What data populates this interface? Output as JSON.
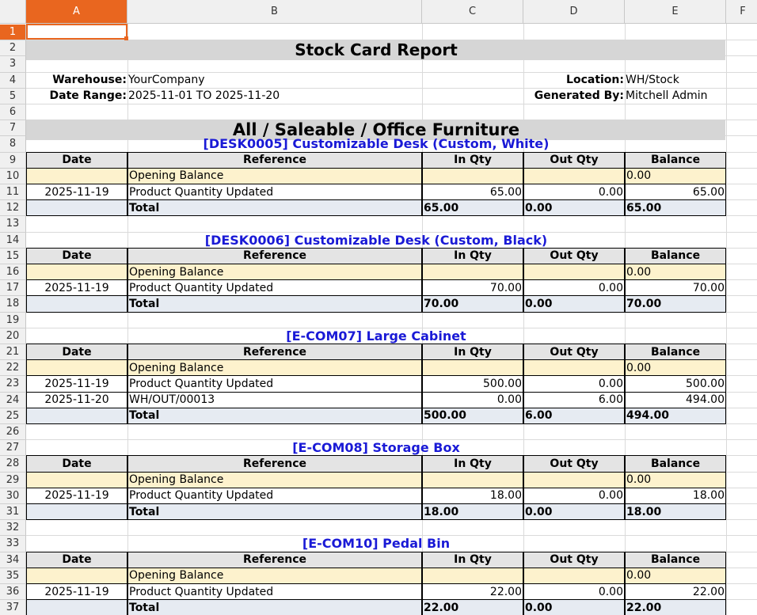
{
  "columns": [
    "A",
    "B",
    "C",
    "D",
    "E",
    "F"
  ],
  "selected_cell": "A1",
  "report": {
    "title": "Stock Card Report",
    "warehouse_label": "Warehouse:",
    "warehouse": "YourCompany",
    "location_label": "Location:",
    "location": "WH/Stock",
    "date_range_label": "Date Range:",
    "date_range": "2025-11-01 TO 2025-11-20",
    "generated_by_label": "Generated By:",
    "generated_by": "Mitchell Admin",
    "category": "All / Saleable / Office Furniture"
  },
  "table_headers": [
    "Date",
    "Reference",
    "In Qty",
    "Out Qty",
    "Balance"
  ],
  "labels": {
    "opening_balance": "Opening Balance",
    "total": "Total"
  },
  "products": [
    {
      "name": "[DESK0005] Customizable Desk (Custom, White)",
      "opening_balance": "0.00",
      "moves": [
        {
          "date": "2025-11-19",
          "reference": "Product Quantity Updated",
          "in": "65.00",
          "out": "0.00",
          "balance": "65.00"
        }
      ],
      "total": {
        "in": "65.00",
        "out": "0.00",
        "balance": "65.00"
      }
    },
    {
      "name": "[DESK0006] Customizable Desk (Custom, Black)",
      "opening_balance": "0.00",
      "moves": [
        {
          "date": "2025-11-19",
          "reference": "Product Quantity Updated",
          "in": "70.00",
          "out": "0.00",
          "balance": "70.00"
        }
      ],
      "total": {
        "in": "70.00",
        "out": "0.00",
        "balance": "70.00"
      }
    },
    {
      "name": "[E-COM07] Large Cabinet",
      "opening_balance": "0.00",
      "moves": [
        {
          "date": "2025-11-19",
          "reference": "Product Quantity Updated",
          "in": "500.00",
          "out": "0.00",
          "balance": "500.00"
        },
        {
          "date": "2025-11-20",
          "reference": "WH/OUT/00013",
          "in": "0.00",
          "out": "6.00",
          "balance": "494.00"
        }
      ],
      "total": {
        "in": "500.00",
        "out": "6.00",
        "balance": "494.00"
      }
    },
    {
      "name": "[E-COM08] Storage Box",
      "opening_balance": "0.00",
      "moves": [
        {
          "date": "2025-11-19",
          "reference": "Product Quantity Updated",
          "in": "18.00",
          "out": "0.00",
          "balance": "18.00"
        }
      ],
      "total": {
        "in": "18.00",
        "out": "0.00",
        "balance": "18.00"
      }
    },
    {
      "name": "[E-COM10] Pedal Bin",
      "opening_balance": "0.00",
      "moves": [
        {
          "date": "2025-11-19",
          "reference": "Product Quantity Updated",
          "in": "22.00",
          "out": "0.00",
          "balance": "22.00"
        }
      ],
      "total": {
        "in": "22.00",
        "out": "0.00",
        "balance": "22.00"
      }
    }
  ]
}
